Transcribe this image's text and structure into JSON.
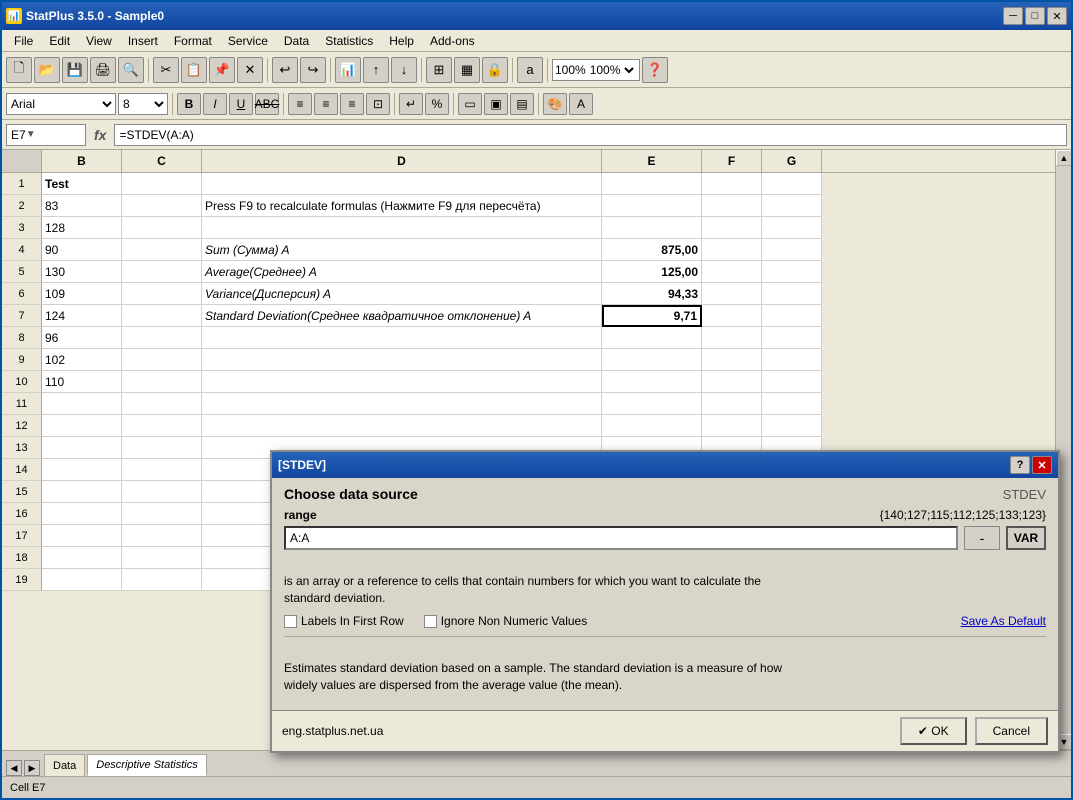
{
  "window": {
    "title": "StatPlus 3.5.0 - Sample0",
    "minimize": "─",
    "maximize": "□",
    "close": "✕"
  },
  "menubar": {
    "items": [
      "File",
      "Edit",
      "View",
      "Insert",
      "Format",
      "Service",
      "Data",
      "Statistics",
      "Help",
      "Add-ons"
    ]
  },
  "toolbar": {
    "zoom": "100%"
  },
  "formulabar": {
    "cell_ref": "E7",
    "fx": "fx",
    "formula": "=STDEV(A:A)"
  },
  "columns": {
    "headers": [
      "B",
      "C",
      "D",
      "E",
      "F",
      "G"
    ]
  },
  "rows": [
    {
      "row": 1,
      "b": "Test",
      "c": "",
      "d": "",
      "e": "",
      "f": "",
      "g": ""
    },
    {
      "row": 2,
      "b": "83",
      "c": "",
      "d": "Press F9 to recalculate formulas (Нажмите F9 для пересчёта)",
      "e": "",
      "f": "",
      "g": ""
    },
    {
      "row": 3,
      "b": "128",
      "c": "",
      "d": "",
      "e": "",
      "f": "",
      "g": ""
    },
    {
      "row": 4,
      "b": "90",
      "c": "",
      "d": "Sum (Сумма) A",
      "e": "875,00",
      "f": "",
      "g": ""
    },
    {
      "row": 5,
      "b": "130",
      "c": "",
      "d": "Average(Среднее) A",
      "e": "125,00",
      "f": "",
      "g": ""
    },
    {
      "row": 6,
      "b": "109",
      "c": "",
      "d": "Variance(Дисперсия) A",
      "e": "94,33",
      "f": "",
      "g": ""
    },
    {
      "row": 7,
      "b": "124",
      "c": "",
      "d": "Standard Deviation(Среднее квадратичное отклонение) A",
      "e": "9,71",
      "f": "",
      "g": ""
    },
    {
      "row": 8,
      "b": "96",
      "c": "",
      "d": "",
      "e": "",
      "f": "",
      "g": ""
    },
    {
      "row": 9,
      "b": "102",
      "c": "",
      "d": "",
      "e": "",
      "f": "",
      "g": ""
    },
    {
      "row": 10,
      "b": "110",
      "c": "",
      "d": "",
      "e": "",
      "f": "",
      "g": ""
    },
    {
      "row": 11,
      "b": "",
      "c": "",
      "d": "",
      "e": "",
      "f": "",
      "g": ""
    },
    {
      "row": 12,
      "b": "",
      "c": "",
      "d": "",
      "e": "",
      "f": "",
      "g": ""
    },
    {
      "row": 13,
      "b": "",
      "c": "",
      "d": "",
      "e": "",
      "f": "",
      "g": ""
    },
    {
      "row": 14,
      "b": "",
      "c": "",
      "d": "",
      "e": "",
      "f": "",
      "g": ""
    },
    {
      "row": 15,
      "b": "",
      "c": "",
      "d": "",
      "e": "",
      "f": "",
      "g": ""
    },
    {
      "row": 16,
      "b": "",
      "c": "",
      "d": "",
      "e": "",
      "f": "",
      "g": ""
    },
    {
      "row": 17,
      "b": "",
      "c": "",
      "d": "",
      "e": "",
      "f": "",
      "g": ""
    },
    {
      "row": 18,
      "b": "",
      "c": "",
      "d": "",
      "e": "",
      "f": "",
      "g": ""
    },
    {
      "row": 19,
      "b": "",
      "c": "",
      "d": "",
      "e": "",
      "f": "",
      "g": ""
    }
  ],
  "sheet_tabs": [
    {
      "label": "Data",
      "active": false
    },
    {
      "label": "Descriptive Statistics",
      "active": true
    }
  ],
  "statusbar": {
    "text": "Cell E7"
  },
  "dialog": {
    "title": "[STDEV]",
    "help_btn": "?",
    "close_btn": "✕",
    "header": "Choose data source",
    "function_label": "STDEV",
    "range_label": "range",
    "range_value": "{140;127;115;112;125;133;123}",
    "input_value": "A:A",
    "minus_label": "-",
    "var_label": "VAR",
    "description": "is an array or a reference to cells that contain numbers for which you want to calculate the\nstandard deviation.",
    "checkbox_labels_first": "Labels In First Row",
    "checkbox_labels_numeric": "Ignore Non Numeric Values",
    "save_default": "Save As Default",
    "footer_desc": "Estimates standard deviation based on a sample. The standard deviation is a measure of how\nwidely values are dispersed from the average value (the mean).",
    "url": "eng.statplus.net.ua",
    "ok_label": "✔  OK",
    "cancel_label": "Cancel"
  }
}
